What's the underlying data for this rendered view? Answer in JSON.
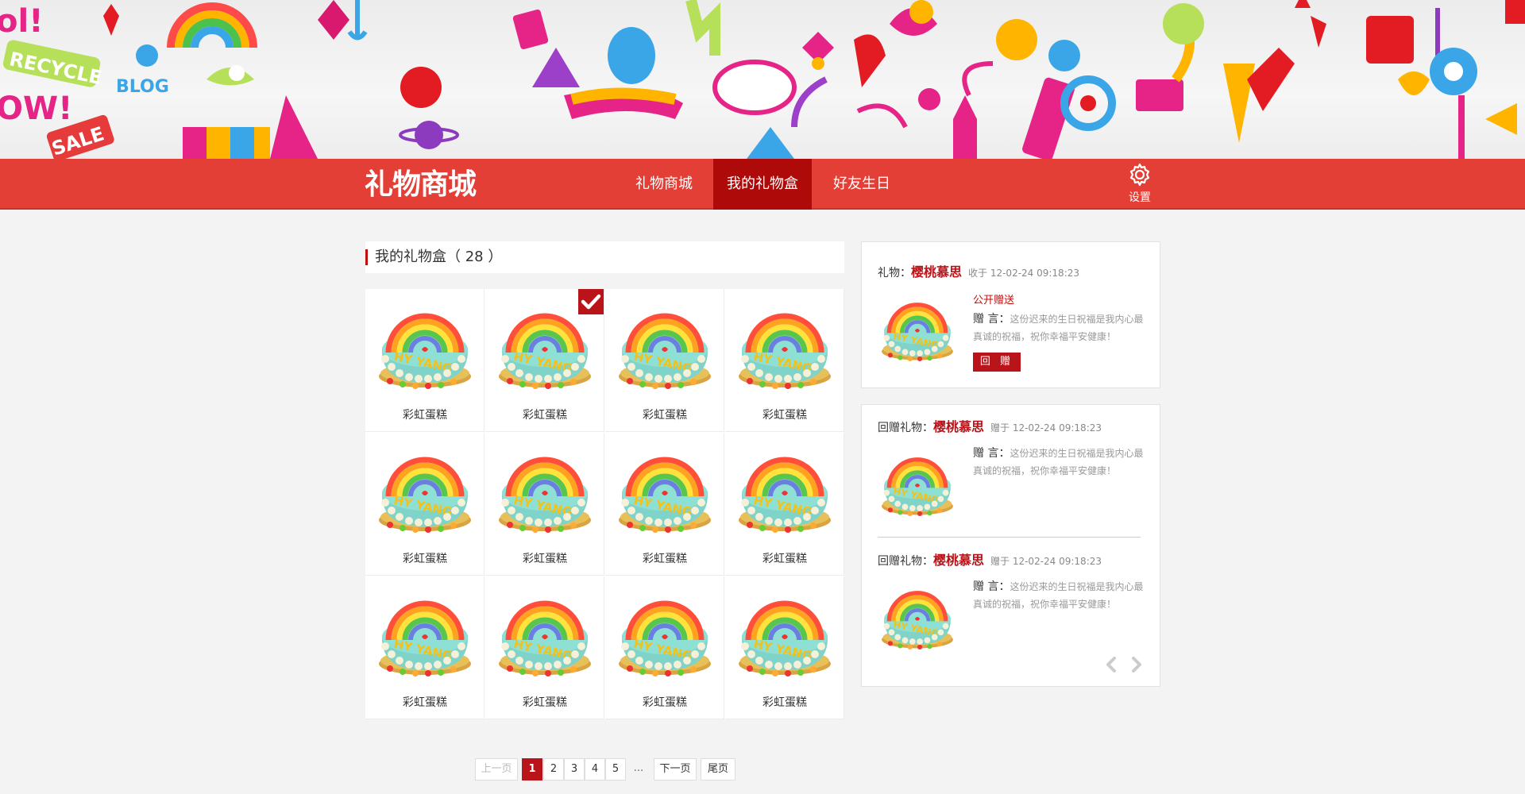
{
  "app": {
    "logo_text": "礼物商城",
    "settings_label": "设置"
  },
  "nav": [
    {
      "label": "礼物商城",
      "active": false
    },
    {
      "label": "我的礼物盒",
      "active": true
    },
    {
      "label": "好友生日",
      "active": false
    }
  ],
  "giftbox": {
    "title": "我的礼物盒（ 28 ）",
    "items": [
      {
        "name": "彩虹蛋糕",
        "checked": false
      },
      {
        "name": "彩虹蛋糕",
        "checked": true
      },
      {
        "name": "彩虹蛋糕",
        "checked": false
      },
      {
        "name": "彩虹蛋糕",
        "checked": false
      },
      {
        "name": "彩虹蛋糕",
        "checked": false
      },
      {
        "name": "彩虹蛋糕",
        "checked": false
      },
      {
        "name": "彩虹蛋糕",
        "checked": false
      },
      {
        "name": "彩虹蛋糕",
        "checked": false
      },
      {
        "name": "彩虹蛋糕",
        "checked": false
      },
      {
        "name": "彩虹蛋糕",
        "checked": false
      },
      {
        "name": "彩虹蛋糕",
        "checked": false
      },
      {
        "name": "彩虹蛋糕",
        "checked": false
      }
    ]
  },
  "pagination": {
    "prev": "上一页",
    "pages": [
      "1",
      "2",
      "3",
      "4",
      "5"
    ],
    "current": "1",
    "dots": "...",
    "next": "下一页",
    "last": "尾页"
  },
  "received": {
    "prefix": "礼物：",
    "sender": "樱桃慕思",
    "time": "收于 12-02-24 09:18:23",
    "tag": "公开赠送",
    "msg_label": "赠  言：",
    "message": "这份迟来的生日祝福是我内心最真诚的祝福，祝你幸福平安健康！",
    "reply_button": "回 赠"
  },
  "returned": [
    {
      "prefix": "回赠礼物：",
      "sender": "樱桃慕思",
      "time": "赠于 12-02-24 09:18:23",
      "msg_label": "赠  言：",
      "message": "这份迟来的生日祝福是我内心最真诚的祝福，祝你幸福平安健康！"
    },
    {
      "prefix": "回赠礼物：",
      "sender": "樱桃慕思",
      "time": "赠于 12-02-24 09:18:23",
      "msg_label": "赠  言：",
      "message": "这份迟来的生日祝福是我内心最真诚的祝福，祝你幸福平安健康！"
    }
  ],
  "colors": {
    "nav_red": "#e43f36",
    "active_red": "#ae0a0a",
    "accent": "#b8141a"
  },
  "icons": {
    "settings": "gear-icon",
    "checked": "checkmark-icon",
    "prev": "chevron-left-icon",
    "next": "chevron-right-icon"
  }
}
